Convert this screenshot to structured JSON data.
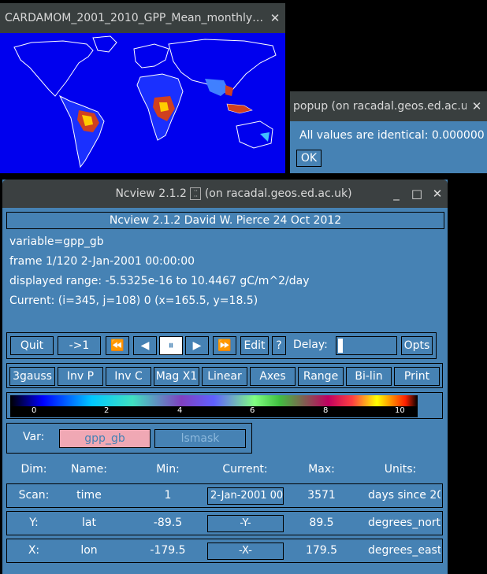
{
  "map_window": {
    "title": "CARDAMOM_2001_2010_GPP_Mean_monthly…",
    "close": "✕"
  },
  "popup": {
    "title": "popup (on racadal.geos.ed.ac.u…",
    "close": "✕",
    "message": "All values are identical: 0.000000",
    "ok_label": "OK"
  },
  "ncview": {
    "title": "Ncview 2.1.2",
    "title_suffix": "(on racadal.geos.ed.ac.uk)",
    "controls": {
      "minimize": "_",
      "maximize": "□",
      "close": "✕"
    },
    "banner": "Ncview 2.1.2 David W. Pierce  24 Oct 2012",
    "info": {
      "variable": "variable=gpp_gb",
      "frame": "frame 1/120 2-Jan-2001 00:00:00",
      "range": "displayed range: -5.5325e-16 to 10.4467 gC/m^2/day",
      "current": "Current: (i=345, j=108) 0 (x=165.5, y=18.5)"
    },
    "toolbar": {
      "quit": "Quit",
      "reset": "->1",
      "rewind": "⏪",
      "back": "◀",
      "pause": "⏸",
      "forward": "▶",
      "fastforward": "⏩",
      "edit": "Edit",
      "help": "?",
      "delay": "Delay:",
      "opts": "Opts"
    },
    "options": {
      "colormap": "3gauss",
      "invp": "Inv P",
      "invc": "Inv C",
      "mag": "Mag X1",
      "scale": "Linear",
      "axes": "Axes",
      "range": "Range",
      "interp": "Bi-lin",
      "print": "Print"
    },
    "colorbar": {
      "ticks": [
        "0",
        "2",
        "4",
        "6",
        "8",
        "10"
      ]
    },
    "vars": {
      "label": "Var:",
      "active": "gpp_gb",
      "inactive": "lsmask",
      "active_color": "#f0a8b4"
    },
    "dims": {
      "headers": {
        "dim": "Dim:",
        "name": "Name:",
        "min": "Min:",
        "current": "Current:",
        "max": "Max:",
        "units": "Units:"
      },
      "rows": [
        {
          "dim": "Scan:",
          "name": "time",
          "min": "1",
          "current": "2-Jan-2001 00",
          "max": "3571",
          "units": "days since 20"
        },
        {
          "dim": "Y:",
          "name": "lat",
          "min": "-89.5",
          "current": "-Y-",
          "max": "89.5",
          "units": "degrees_nort"
        },
        {
          "dim": "X:",
          "name": "lon",
          "min": "-179.5",
          "current": "-X-",
          "max": "179.5",
          "units": "degrees_east"
        }
      ]
    }
  },
  "colors": {
    "bg": "#4682b4",
    "map_ocean": "#0000ee",
    "titlebar": "#2e3436"
  }
}
